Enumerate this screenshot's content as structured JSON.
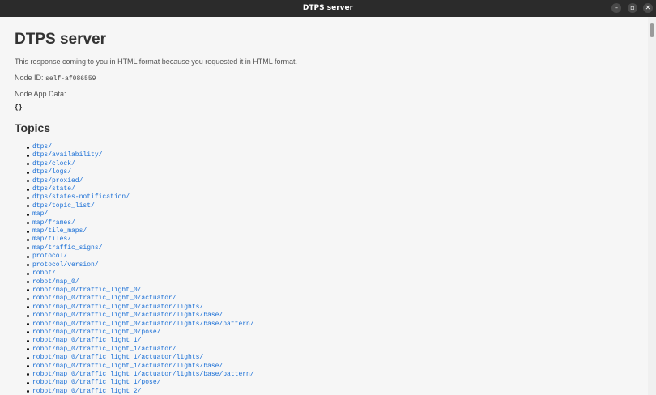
{
  "window": {
    "title": "DTPS server",
    "minimize_glyph": "–",
    "maximize_glyph": "▫",
    "close_glyph": "✕"
  },
  "page": {
    "heading": "DTPS server",
    "intro": "This response coming to you in HTML format because you requested it in HTML format.",
    "node_id_label": "Node ID:",
    "node_id_value": "self-af086559",
    "app_data_label": "Node App Data:",
    "app_data_value": "{}",
    "topics_heading": "Topics"
  },
  "topics": [
    "dtps/",
    "dtps/availability/",
    "dtps/clock/",
    "dtps/logs/",
    "dtps/proxied/",
    "dtps/state/",
    "dtps/states-notification/",
    "dtps/topic_list/",
    "map/",
    "map/frames/",
    "map/tile_maps/",
    "map/tiles/",
    "map/traffic_signs/",
    "protocol/",
    "protocol/version/",
    "robot/",
    "robot/map_0/",
    "robot/map_0/traffic_light_0/",
    "robot/map_0/traffic_light_0/actuator/",
    "robot/map_0/traffic_light_0/actuator/lights/",
    "robot/map_0/traffic_light_0/actuator/lights/base/",
    "robot/map_0/traffic_light_0/actuator/lights/base/pattern/",
    "robot/map_0/traffic_light_0/pose/",
    "robot/map_0/traffic_light_1/",
    "robot/map_0/traffic_light_1/actuator/",
    "robot/map_0/traffic_light_1/actuator/lights/",
    "robot/map_0/traffic_light_1/actuator/lights/base/",
    "robot/map_0/traffic_light_1/actuator/lights/base/pattern/",
    "robot/map_0/traffic_light_1/pose/",
    "robot/map_0/traffic_light_2/"
  ]
}
